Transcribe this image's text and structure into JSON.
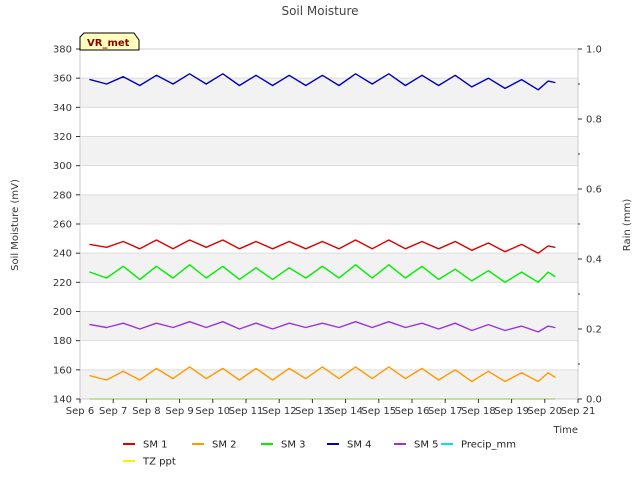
{
  "chart_data": {
    "type": "line",
    "title": "Soil Moisture",
    "xlabel": "Time",
    "ylabel": "Soil Moisture (mV)",
    "y2label": "Rain (mm)",
    "badge": "VR_met",
    "x_ticks": [
      "Sep 6",
      "Sep 7",
      "Sep 8",
      "Sep 9",
      "Sep 10",
      "Sep 11",
      "Sep 12",
      "Sep 13",
      "Sep 14",
      "Sep 15",
      "Sep 16",
      "Sep 17",
      "Sep 18",
      "Sep 19",
      "Sep 20",
      "Sep 21"
    ],
    "xlim": [
      6,
      21
    ],
    "ylim": [
      140,
      380
    ],
    "y_ticks": [
      140,
      160,
      180,
      200,
      220,
      240,
      260,
      280,
      300,
      320,
      340,
      360,
      380
    ],
    "y2lim": [
      0.0,
      1.0
    ],
    "y2_ticks": [
      "0.0",
      "0.2",
      "0.4",
      "0.6",
      "0.8",
      "1.0"
    ],
    "grid": true,
    "legend_position": "bottom",
    "series": [
      {
        "name": "SM 1",
        "color": "#dd0000",
        "x": [
          6.3,
          6.8,
          7.3,
          7.8,
          8.3,
          8.8,
          9.3,
          9.8,
          10.3,
          10.8,
          11.3,
          11.8,
          12.3,
          12.8,
          13.3,
          13.8,
          14.3,
          14.8,
          15.3,
          15.8,
          16.3,
          16.8,
          17.3,
          17.8,
          18.3,
          18.8,
          19.3,
          19.8,
          20.1,
          20.3
        ],
        "y": [
          246,
          244,
          248,
          243,
          249,
          243,
          249,
          244,
          249,
          243,
          248,
          243,
          248,
          243,
          248,
          243,
          249,
          243,
          249,
          243,
          248,
          243,
          248,
          242,
          247,
          241,
          246,
          240,
          245,
          244
        ]
      },
      {
        "name": "SM 2",
        "color": "#ff9900",
        "x": [
          6.3,
          6.8,
          7.3,
          7.8,
          8.3,
          8.8,
          9.3,
          9.8,
          10.3,
          10.8,
          11.3,
          11.8,
          12.3,
          12.8,
          13.3,
          13.8,
          14.3,
          14.8,
          15.3,
          15.8,
          16.3,
          16.8,
          17.3,
          17.8,
          18.3,
          18.8,
          19.3,
          19.8,
          20.1,
          20.3
        ],
        "y": [
          156,
          153,
          159,
          153,
          161,
          154,
          162,
          154,
          161,
          153,
          161,
          153,
          161,
          154,
          162,
          154,
          162,
          154,
          162,
          154,
          161,
          153,
          160,
          152,
          159,
          152,
          158,
          152,
          158,
          155
        ]
      },
      {
        "name": "SM 3",
        "color": "#00ee00",
        "x": [
          6.3,
          6.8,
          7.3,
          7.8,
          8.3,
          8.8,
          9.3,
          9.8,
          10.3,
          10.8,
          11.3,
          11.8,
          12.3,
          12.8,
          13.3,
          13.8,
          14.3,
          14.8,
          15.3,
          15.8,
          16.3,
          16.8,
          17.3,
          17.8,
          18.3,
          18.8,
          19.3,
          19.8,
          20.1,
          20.3
        ],
        "y": [
          227,
          223,
          231,
          222,
          231,
          223,
          232,
          223,
          231,
          222,
          230,
          222,
          230,
          223,
          231,
          223,
          232,
          223,
          232,
          223,
          231,
          222,
          229,
          221,
          228,
          220,
          227,
          220,
          227,
          224
        ]
      },
      {
        "name": "SM 4",
        "color": "#0000bb",
        "x": [
          6.3,
          6.8,
          7.3,
          7.8,
          8.3,
          8.8,
          9.3,
          9.8,
          10.3,
          10.8,
          11.3,
          11.8,
          12.3,
          12.8,
          13.3,
          13.8,
          14.3,
          14.8,
          15.3,
          15.8,
          16.3,
          16.8,
          17.3,
          17.8,
          18.3,
          18.8,
          19.3,
          19.8,
          20.1,
          20.3
        ],
        "y": [
          359,
          356,
          361,
          355,
          362,
          356,
          363,
          356,
          363,
          355,
          362,
          355,
          362,
          355,
          362,
          355,
          363,
          356,
          363,
          355,
          362,
          355,
          362,
          354,
          360,
          353,
          359,
          352,
          358,
          357
        ]
      },
      {
        "name": "SM 5",
        "color": "#9933dd",
        "x": [
          6.3,
          6.8,
          7.3,
          7.8,
          8.3,
          8.8,
          9.3,
          9.8,
          10.3,
          10.8,
          11.3,
          11.8,
          12.3,
          12.8,
          13.3,
          13.8,
          14.3,
          14.8,
          15.3,
          15.8,
          16.3,
          16.8,
          17.3,
          17.8,
          18.3,
          18.8,
          19.3,
          19.8,
          20.1,
          20.3
        ],
        "y": [
          191,
          189,
          192,
          188,
          192,
          189,
          193,
          189,
          193,
          188,
          192,
          188,
          192,
          189,
          192,
          189,
          193,
          189,
          193,
          189,
          192,
          188,
          192,
          187,
          191,
          187,
          190,
          186,
          190,
          189
        ]
      },
      {
        "name": "Precip_mm",
        "color": "#00e5e5",
        "axis": "right",
        "x": [
          6.3,
          20.3
        ],
        "y": [
          0.0,
          0.0
        ]
      },
      {
        "name": "TZ ppt",
        "color": "#ffee00",
        "x": [
          6.3,
          20.3
        ],
        "y": [
          140,
          140
        ]
      }
    ]
  }
}
